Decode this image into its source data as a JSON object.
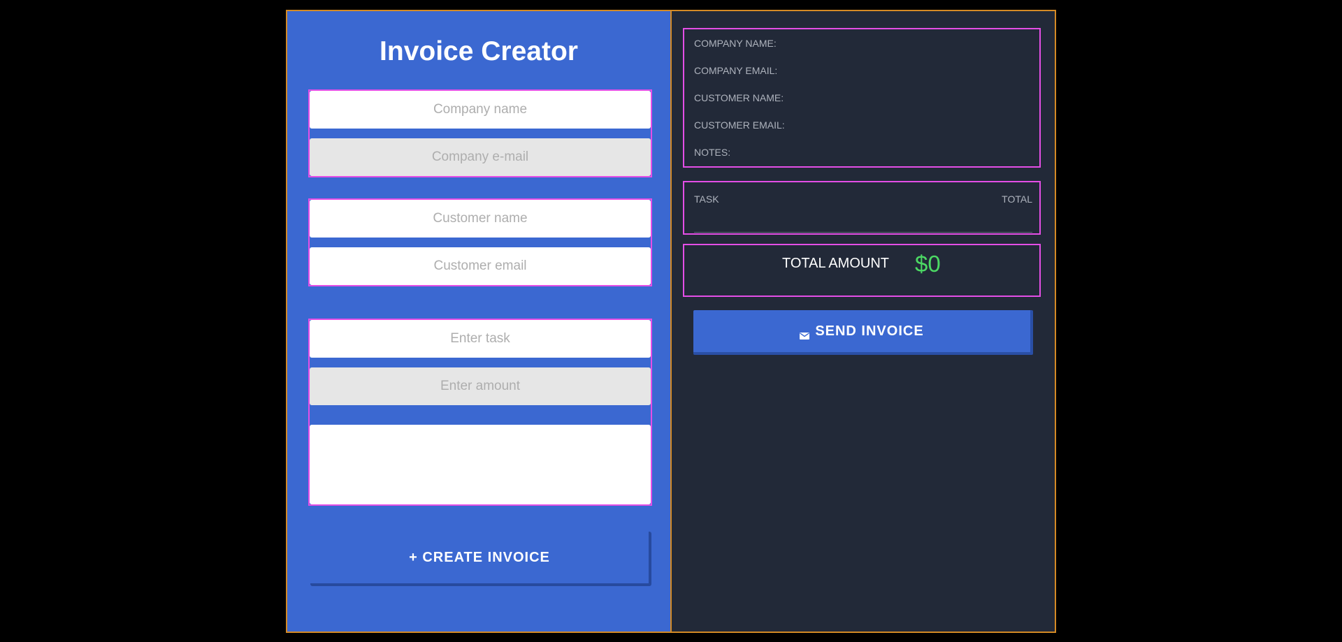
{
  "form": {
    "title": "Invoice Creator",
    "company_name_placeholder": "Company name",
    "company_email_placeholder": "Company e-mail",
    "customer_name_placeholder": "Customer name",
    "customer_email_placeholder": "Customer email",
    "task_placeholder": "Enter task",
    "amount_placeholder": "Enter amount",
    "notes_value": "",
    "create_button_icon": "+",
    "create_button_label": "CREATE INVOICE"
  },
  "preview": {
    "labels": {
      "company_name": "COMPANY NAME:",
      "company_email": "COMPANY EMAIL:",
      "customer_name": "CUSTOMER NAME:",
      "customer_email": "CUSTOMER EMAIL:",
      "notes": "NOTES:"
    },
    "table": {
      "headers": [
        "TASK",
        "TOTAL"
      ]
    },
    "total_label": "TOTAL AMOUNT",
    "total_value": "$0",
    "send_button_icon": "envelope-icon",
    "send_button_label": "SEND INVOICE"
  },
  "colors": {
    "panel_blue": "#3b68d1",
    "panel_dark": "#222938",
    "frame_orange": "#d48a25",
    "outline_magenta": "#e44ee6",
    "total_green": "#4cd964"
  }
}
